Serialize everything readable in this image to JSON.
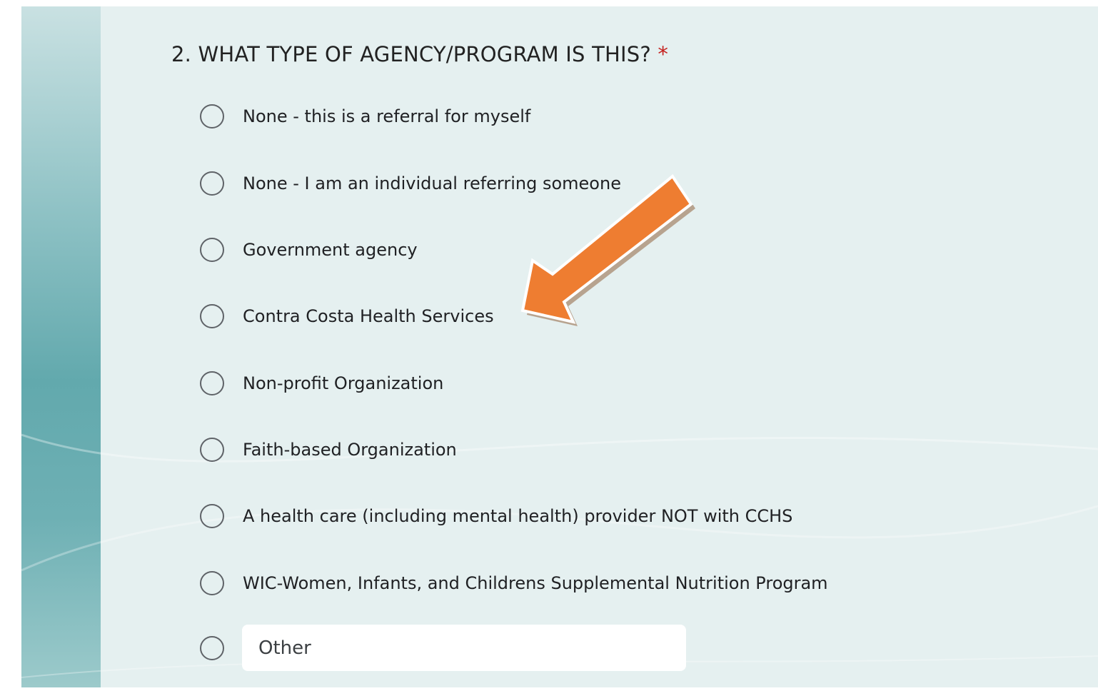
{
  "question": {
    "title": "2. WHAT TYPE OF AGENCY/PROGRAM IS THIS?",
    "required_marker": "*"
  },
  "options": [
    {
      "label": "None - this is a referral for myself",
      "selected": false
    },
    {
      "label": "None - I am an individual referring someone",
      "selected": false
    },
    {
      "label": "Government agency",
      "selected": false
    },
    {
      "label": "Contra Costa Health Services",
      "selected": false
    },
    {
      "label": "Non-profit Organization",
      "selected": false
    },
    {
      "label": "Faith-based Organization",
      "selected": false
    },
    {
      "label": "A health care (including mental health) provider NOT with CCHS",
      "selected": false
    },
    {
      "label": "WIC-Women, Infants, and Childrens Supplemental Nutrition Program",
      "selected": false
    }
  ],
  "other_option": {
    "placeholder": "Other",
    "value": "",
    "selected": false
  },
  "colors": {
    "background": "#e5f0f0",
    "teal_band": "#62a9ad",
    "required": "#c5221f",
    "arrow": "#ee7d31"
  }
}
